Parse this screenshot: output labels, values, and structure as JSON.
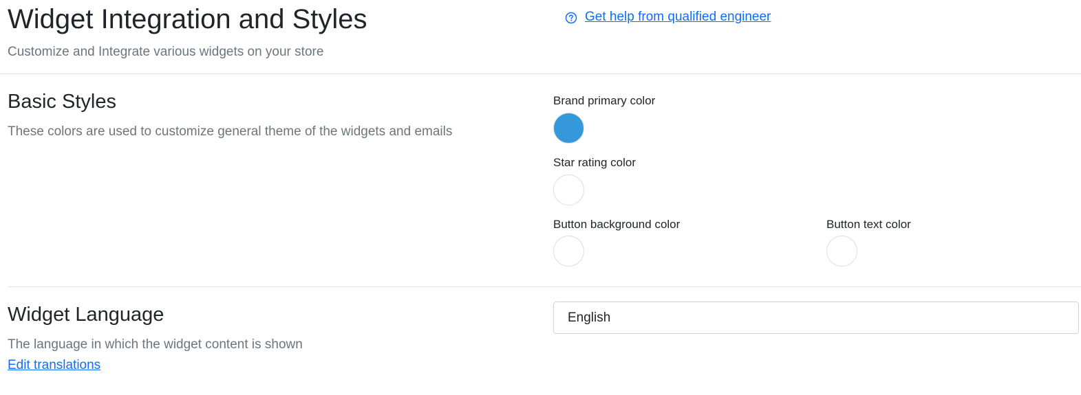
{
  "header": {
    "title": "Widget Integration and Styles",
    "subtitle": "Customize and Integrate various widgets on your store",
    "help_link": "Get help from qualified engineer",
    "help_icon": "question-circle-icon"
  },
  "basic_styles": {
    "title": "Basic Styles",
    "description": "These colors are used to customize general theme of the widgets and emails",
    "colors": [
      {
        "label": "Brand primary color",
        "value": "#3498db"
      },
      {
        "label": "Star rating color",
        "value": "#ffffff"
      },
      {
        "label": "Button background color",
        "value": "#ffffff"
      },
      {
        "label": "Button text color",
        "value": "#ffffff"
      }
    ]
  },
  "widget_language": {
    "title": "Widget Language",
    "description": "The language in which the widget content is shown",
    "edit_link": "Edit translations",
    "selected": "English"
  },
  "theme": {
    "link_color": "#0d6efd",
    "muted_text": "#6c757d",
    "divider": "#dee2e6"
  }
}
